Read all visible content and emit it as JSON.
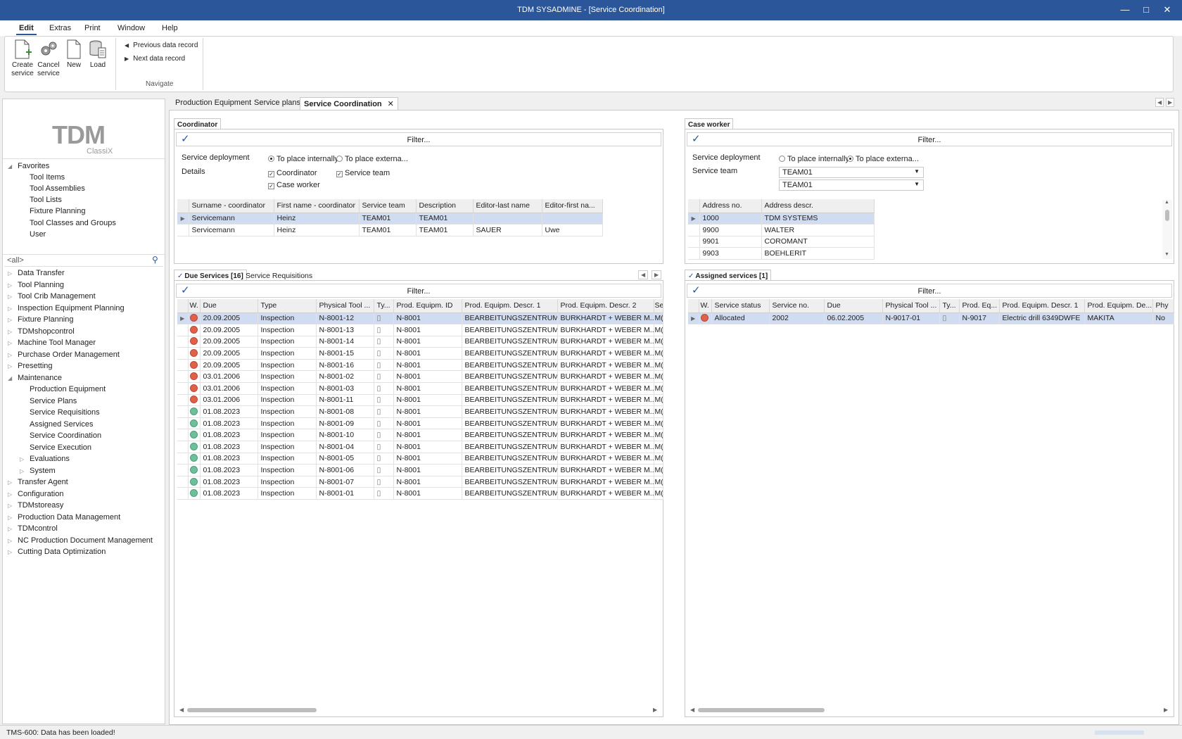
{
  "window": {
    "title": "TDM SYSADMINE - [Service Coordination]"
  },
  "menu": {
    "items": [
      "Edit",
      "Extras",
      "Print",
      "Window",
      "Help"
    ]
  },
  "ribbon": {
    "create_service": [
      "Create",
      "service"
    ],
    "cancel_service": [
      "Cancel",
      "service"
    ],
    "new": "New",
    "load": "Load",
    "prev": "Previous data record",
    "next": "Next data record",
    "group": "Navigate"
  },
  "sidebar": {
    "logo": "TDM",
    "logo_sub": "ClassiX",
    "favorites": "Favorites",
    "fav_items": [
      "Tool Items",
      "Tool Assemblies",
      "Tool Lists",
      "Fixture Planning",
      "Tool Classes and Groups",
      "User"
    ],
    "search": "<all>",
    "modules": [
      "Data Transfer",
      "Tool Planning",
      "Tool Crib Management",
      "Inspection Equipment Planning",
      "Fixture Planning",
      "TDMshopcontrol",
      "Machine Tool Manager",
      "Purchase Order Management",
      "Presetting",
      "Maintenance"
    ],
    "maintenance_items": [
      "Production Equipment",
      "Service Plans",
      "Service Requisitions",
      "Assigned Services",
      "Service Coordination",
      "Service Execution",
      "Evaluations",
      "System"
    ],
    "modules_after": [
      "Transfer Agent",
      "Configuration",
      "TDMstoreasy",
      "Production Data Management",
      "TDMcontrol",
      "NC Production Document Management",
      "Cutting Data Optimization"
    ]
  },
  "doctabs": [
    "Production Equipment",
    "Service plans",
    "Service Coordination"
  ],
  "coordinator": {
    "tab": "Coordinator",
    "filter": "Filter...",
    "service_deployment": "Service deployment",
    "opt_internal": "To place internally",
    "opt_external": "To place externa...",
    "details": "Details",
    "cb_coordinator": "Coordinator",
    "cb_service_team": "Service team",
    "cb_case_worker": "Case worker",
    "columns": [
      "Surname - coordinator",
      "First name - coordinator",
      "Service team",
      "Description",
      "Editor-last name",
      "Editor-first na..."
    ],
    "rows": [
      [
        "Servicemann",
        "Heinz",
        "TEAM01",
        "TEAM01",
        "",
        ""
      ],
      [
        "Servicemann",
        "Heinz",
        "TEAM01",
        "TEAM01",
        "SAUER",
        "Uwe"
      ]
    ]
  },
  "caseworker": {
    "tab": "Case worker",
    "filter": "Filter...",
    "service_deployment": "Service deployment",
    "opt_internal": "To place internally",
    "opt_external": "To place externa...",
    "service_team": "Service team",
    "team1": "TEAM01",
    "team2": "TEAM01",
    "columns": [
      "Address no.",
      "Address descr."
    ],
    "rows": [
      [
        "1000",
        "TDM SYSTEMS"
      ],
      [
        "9900",
        "WALTER"
      ],
      [
        "9901",
        "COROMANT"
      ],
      [
        "9903",
        "BOEHLERIT"
      ]
    ]
  },
  "due": {
    "tab1": "Due Services [16]",
    "tab2": "Service Requisitions",
    "filter": "Filter...",
    "columns": [
      "W.",
      "Due",
      "Type",
      "Physical Tool ...",
      "Ty...",
      "Prod. Equipm. ID",
      "Prod. Equipm. Descr. 1",
      "Prod. Equipm. Descr. 2",
      "Se"
    ],
    "rows": [
      [
        "red",
        "20.09.2005",
        "Inspection",
        "N-8001-12",
        "N-8001",
        "BEARBEITUNGSZENTRUM",
        "BURKHARDT + WEBER M...",
        "M("
      ],
      [
        "red",
        "20.09.2005",
        "Inspection",
        "N-8001-13",
        "N-8001",
        "BEARBEITUNGSZENTRUM",
        "BURKHARDT + WEBER M...",
        "M("
      ],
      [
        "red",
        "20.09.2005",
        "Inspection",
        "N-8001-14",
        "N-8001",
        "BEARBEITUNGSZENTRUM",
        "BURKHARDT + WEBER M...",
        "M("
      ],
      [
        "red",
        "20.09.2005",
        "Inspection",
        "N-8001-15",
        "N-8001",
        "BEARBEITUNGSZENTRUM",
        "BURKHARDT + WEBER M...",
        "M("
      ],
      [
        "red",
        "20.09.2005",
        "Inspection",
        "N-8001-16",
        "N-8001",
        "BEARBEITUNGSZENTRUM",
        "BURKHARDT + WEBER M...",
        "M("
      ],
      [
        "red",
        "03.01.2006",
        "Inspection",
        "N-8001-02",
        "N-8001",
        "BEARBEITUNGSZENTRUM",
        "BURKHARDT + WEBER M...",
        "M("
      ],
      [
        "red",
        "03.01.2006",
        "Inspection",
        "N-8001-03",
        "N-8001",
        "BEARBEITUNGSZENTRUM",
        "BURKHARDT + WEBER M...",
        "M("
      ],
      [
        "red",
        "03.01.2006",
        "Inspection",
        "N-8001-11",
        "N-8001",
        "BEARBEITUNGSZENTRUM",
        "BURKHARDT + WEBER M...",
        "M("
      ],
      [
        "green",
        "01.08.2023",
        "Inspection",
        "N-8001-08",
        "N-8001",
        "BEARBEITUNGSZENTRUM",
        "BURKHARDT + WEBER M...",
        "M("
      ],
      [
        "green",
        "01.08.2023",
        "Inspection",
        "N-8001-09",
        "N-8001",
        "BEARBEITUNGSZENTRUM",
        "BURKHARDT + WEBER M...",
        "M("
      ],
      [
        "green",
        "01.08.2023",
        "Inspection",
        "N-8001-10",
        "N-8001",
        "BEARBEITUNGSZENTRUM",
        "BURKHARDT + WEBER M...",
        "M("
      ],
      [
        "green",
        "01.08.2023",
        "Inspection",
        "N-8001-04",
        "N-8001",
        "BEARBEITUNGSZENTRUM",
        "BURKHARDT + WEBER M...",
        "M("
      ],
      [
        "green",
        "01.08.2023",
        "Inspection",
        "N-8001-05",
        "N-8001",
        "BEARBEITUNGSZENTRUM",
        "BURKHARDT + WEBER M...",
        "M("
      ],
      [
        "green",
        "01.08.2023",
        "Inspection",
        "N-8001-06",
        "N-8001",
        "BEARBEITUNGSZENTRUM",
        "BURKHARDT + WEBER M...",
        "M("
      ],
      [
        "green",
        "01.08.2023",
        "Inspection",
        "N-8001-07",
        "N-8001",
        "BEARBEITUNGSZENTRUM",
        "BURKHARDT + WEBER M...",
        "M("
      ],
      [
        "green",
        "01.08.2023",
        "Inspection",
        "N-8001-01",
        "N-8001",
        "BEARBEITUNGSZENTRUM",
        "BURKHARDT + WEBER M...",
        "M("
      ]
    ]
  },
  "assigned": {
    "tab": "Assigned services [1]",
    "filter": "Filter...",
    "columns": [
      "W.",
      "Service status",
      "Service no.",
      "Due",
      "Physical Tool ...",
      "Ty...",
      "Prod. Eq...",
      "Prod. Equipm. Descr. 1",
      "Prod. Equipm. De...",
      "Phy"
    ],
    "rows": [
      [
        "red",
        "Allocated",
        "2002",
        "06.02.2005",
        "N-9017-01",
        "N-9017",
        "Electric drill 6349DWFE",
        "MAKITA",
        "No"
      ]
    ]
  },
  "status": {
    "text": "TMS-600: Data has been loaded!"
  },
  "colors": {
    "titlebar": "#2b579a",
    "selection": "#cfdcf1",
    "overdue": "#e0604a",
    "ok": "#6fbf9a"
  }
}
